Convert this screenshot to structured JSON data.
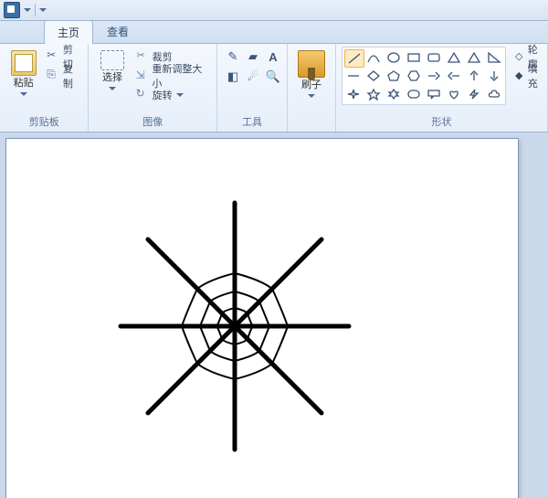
{
  "tabs": {
    "home": "主页",
    "view": "查看"
  },
  "clipboard": {
    "paste": "粘贴",
    "cut": "剪切",
    "copy": "复制",
    "group_label": "剪贴板"
  },
  "image": {
    "select": "选择",
    "crop": "裁剪",
    "resize": "重新调整大小",
    "rotate": "旋转",
    "group_label": "图像"
  },
  "tools": {
    "group_label": "工具",
    "text_tool": "A",
    "items": [
      "pencil",
      "fill",
      "text",
      "eraser",
      "picker",
      "magnifier"
    ]
  },
  "brushes": {
    "label": "刷子"
  },
  "shapes": {
    "group_label": "形状",
    "outline": "轮廓",
    "fill": "填充",
    "items": [
      "line",
      "curve",
      "oval",
      "rect",
      "round-rect",
      "polygon",
      "triangle",
      "right-triangle",
      "line2",
      "diamond",
      "pentagon",
      "hexagon",
      "arrow-right",
      "arrow-left",
      "arrow-up",
      "arrow-down",
      "star4",
      "star5",
      "star6",
      "rounded",
      "callout",
      "heart",
      "lightning",
      "cloud"
    ]
  },
  "colors": {
    "accent_orange": "#e8a33a",
    "ribbon_blue": "#cfe0f3"
  },
  "canvas": {
    "drawing_description": "spider-web"
  }
}
